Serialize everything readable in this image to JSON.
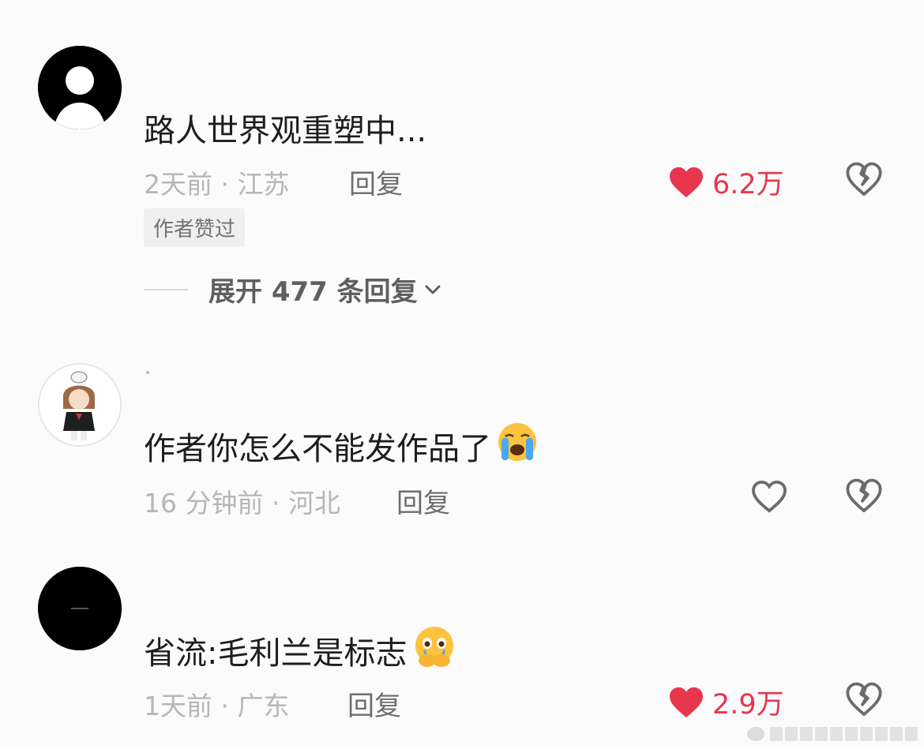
{
  "comments": [
    {
      "text": "路人世界观重塑中...",
      "meta": "2天前 · 江苏",
      "reply_label": "回复",
      "likes": "6.2万",
      "liked": true,
      "badge": "作者赞过",
      "expand_label": "展开 477 条回复",
      "emoji": ""
    },
    {
      "text": "作者你怎么不能发作品了",
      "meta": "16 分钟前 · 河北",
      "reply_label": "回复",
      "likes": "",
      "liked": false,
      "emoji": "loudly-crying-face"
    },
    {
      "text": "省流:毛利兰是标志",
      "meta": "1天前 · 广东",
      "reply_label": "回复",
      "likes": "2.9万",
      "liked": true,
      "emoji": "face-holding-back-tears"
    }
  ],
  "colors": {
    "like_red": "#e8364f",
    "meta_gray": "#b6b6b6",
    "icon_gray": "#6b6b6b"
  },
  "icons": [
    "default-avatar-icon",
    "heart-icon",
    "broken-heart-icon",
    "chevron-down-icon"
  ]
}
